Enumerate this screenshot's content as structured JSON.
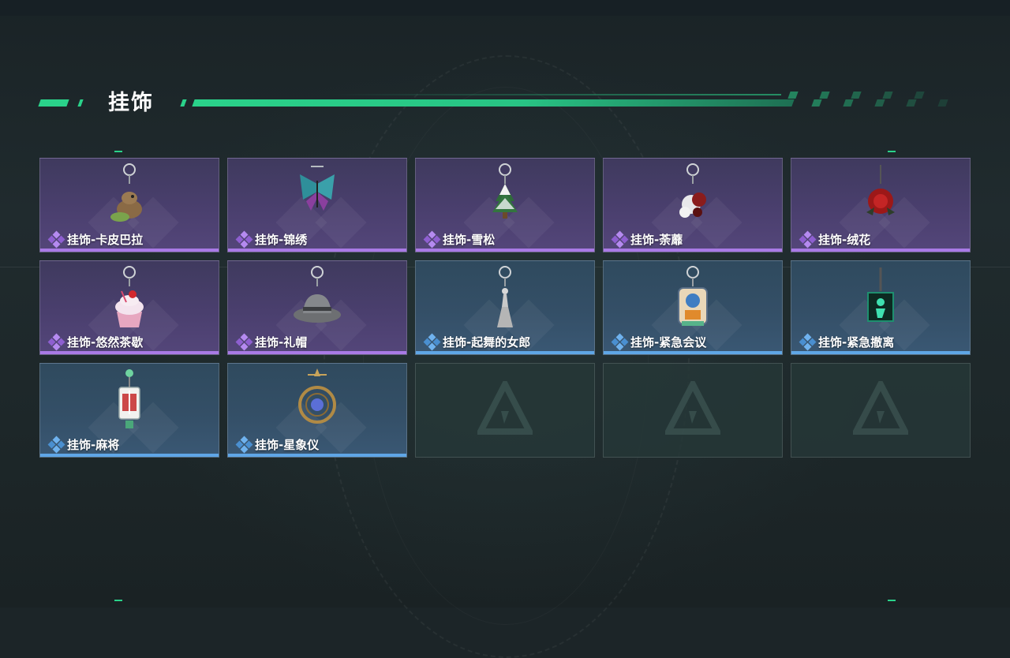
{
  "header": {
    "title": "挂饰"
  },
  "colors": {
    "accent": "#2ad28a",
    "rare_purple": "#a97ae6",
    "rare_blue": "#5fa6e6",
    "card_purple": "#4a3f6e",
    "card_blue": "#344f67",
    "card_empty": "#263737"
  },
  "items": [
    {
      "label": "挂饰-卡皮巴拉",
      "rarity": "purple",
      "icon": "capybara-charm-icon"
    },
    {
      "label": "挂饰-锦绣",
      "rarity": "purple",
      "icon": "butterfly-charm-icon"
    },
    {
      "label": "挂饰-雪松",
      "rarity": "purple",
      "icon": "snow-pine-charm-icon"
    },
    {
      "label": "挂饰-荼蘼",
      "rarity": "purple",
      "icon": "flower-charm-icon"
    },
    {
      "label": "挂饰-绒花",
      "rarity": "purple",
      "icon": "red-rose-charm-icon"
    },
    {
      "label": "挂饰-悠然茶歇",
      "rarity": "purple",
      "icon": "cupcake-charm-icon"
    },
    {
      "label": "挂饰-礼帽",
      "rarity": "purple",
      "icon": "fedora-hat-charm-icon"
    },
    {
      "label": "挂饰-起舞的女郎",
      "rarity": "blue",
      "icon": "dancing-lady-charm-icon"
    },
    {
      "label": "挂饰-紧急会议",
      "rarity": "blue",
      "icon": "meeting-badge-charm-icon"
    },
    {
      "label": "挂饰-紧急撤离",
      "rarity": "blue",
      "icon": "exit-sign-charm-icon"
    },
    {
      "label": "挂饰-麻将",
      "rarity": "blue",
      "icon": "mahjong-tile-charm-icon"
    },
    {
      "label": "挂饰-星象仪",
      "rarity": "blue",
      "icon": "astrolabe-charm-icon"
    },
    {
      "label": "",
      "rarity": "empty",
      "icon": "empty-slot-logo-icon"
    },
    {
      "label": "",
      "rarity": "empty",
      "icon": "empty-slot-logo-icon"
    },
    {
      "label": "",
      "rarity": "empty",
      "icon": "empty-slot-logo-icon"
    }
  ]
}
